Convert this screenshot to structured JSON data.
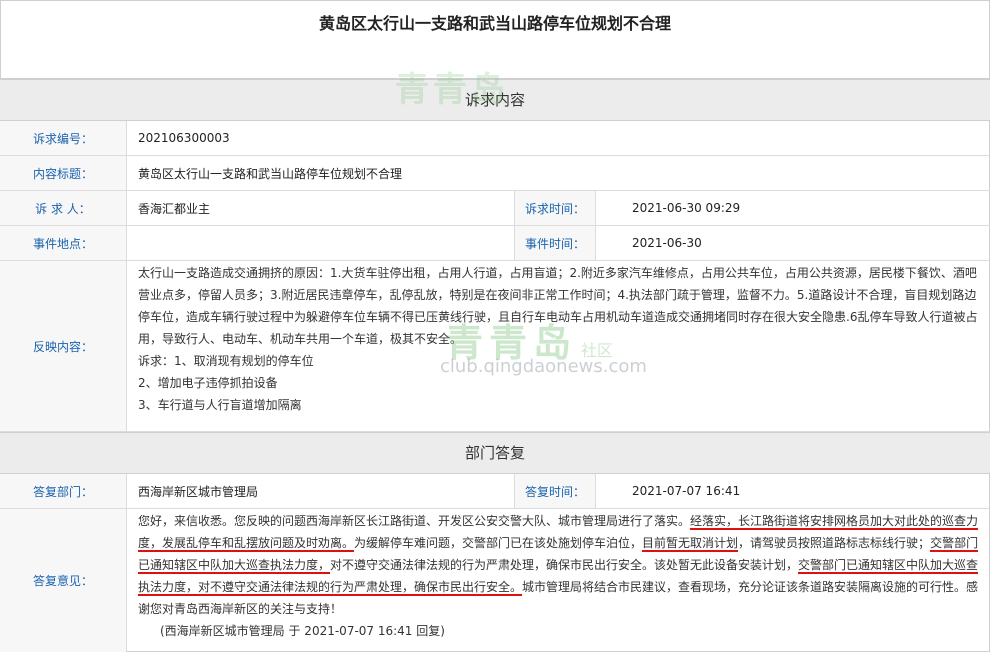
{
  "title": "黄岛区太行山一支路和武当山路停车位规划不合理",
  "appeal_section": "诉求内容",
  "fields": {
    "id_label": "诉求编号：",
    "id_value": "202106300003",
    "subject_label": "内容标题：",
    "subject_value": "黄岛区太行山一支路和武当山路停车位规划不合理",
    "requester_label": "诉 求 人：",
    "requester_value": "香海汇都业主",
    "time_label": "诉求时间：",
    "time_value": "2021-06-30 09:29",
    "location_label": "事件地点：",
    "location_value": "",
    "event_time_label": "事件时间：",
    "event_time_value": "2021-06-30",
    "content_label": "反映内容："
  },
  "content": {
    "paragraph": "太行山一支路造成交通拥挤的原因：1.大货车驻停出租，占用人行道，占用盲道；2.附近多家汽车维修点，占用公共车位，占用公共资源，居民楼下餐饮、酒吧营业点多，停留人员多；3.附近居民违章停车，乱停乱放，特别是在夜间非正常工作时间；4.执法部门疏于管理，监督不力。5.道路设计不合理，盲目规划路边停车位，造成车辆行驶过程中为躲避停车位车辆不得已压黄线行驶，且自行车电动车占用机动车道造成交通拥堵同时存在很大安全隐患.6乱停车导致人行道被占用，导致行人、电动车、机动车共用一个车道，极其不安全。",
    "demand_1": "诉求：1、取消现有规划的停车位",
    "demand_2": "2、增加电子违停抓拍设备",
    "demand_3": "3、车行道与人行盲道增加隔离"
  },
  "reply_section": "部门答复",
  "reply": {
    "dept_label": "答复部门：",
    "dept_value": "西海岸新区城市管理局",
    "time_label": "答复时间：",
    "time_value": "2021-07-07 16:41",
    "opinion_label": "答复意见：",
    "s1": "您好，来信收悉。您反映的问题西海岸新区长江路街道、开发区公安交警大队、城市管理局进行了落实。",
    "s2": "经落实，长江路街道将安排网格员加大对此处的巡查力度，发展乱停车和乱摆放问题及时劝离。",
    "s3": "为缓解停车难问题，交警部门已在该处施划停车泊位，",
    "s4": "目前暂无取消计划",
    "s5": "，请驾驶员按照道路标志标线行驶；",
    "s6": "交警部门已通知辖区中队加大巡查执法力度，",
    "s7": "对不遵守交通法律法规的行为严肃处理，确保市民出行安全。",
    "s8": "该处暂无此设备安装计划，",
    "s9": "交警部门已通知辖区中队加大巡查执法力度，对不遵守交通法律法规的行为严肃处理，确保市民出行安全。",
    "s10": "城市管理局将结合市民建议，查看现场，充分论证该条道路安装隔离设施的可行性。感谢您对青岛西海岸新区的关注与支持！",
    "signature": "(西海岸新区城市管理局 于 2021-07-07 16:41 回复)"
  },
  "watermark": {
    "brand": "青青岛",
    "sub": "社区",
    "url": "club.qingdaonews.com"
  }
}
